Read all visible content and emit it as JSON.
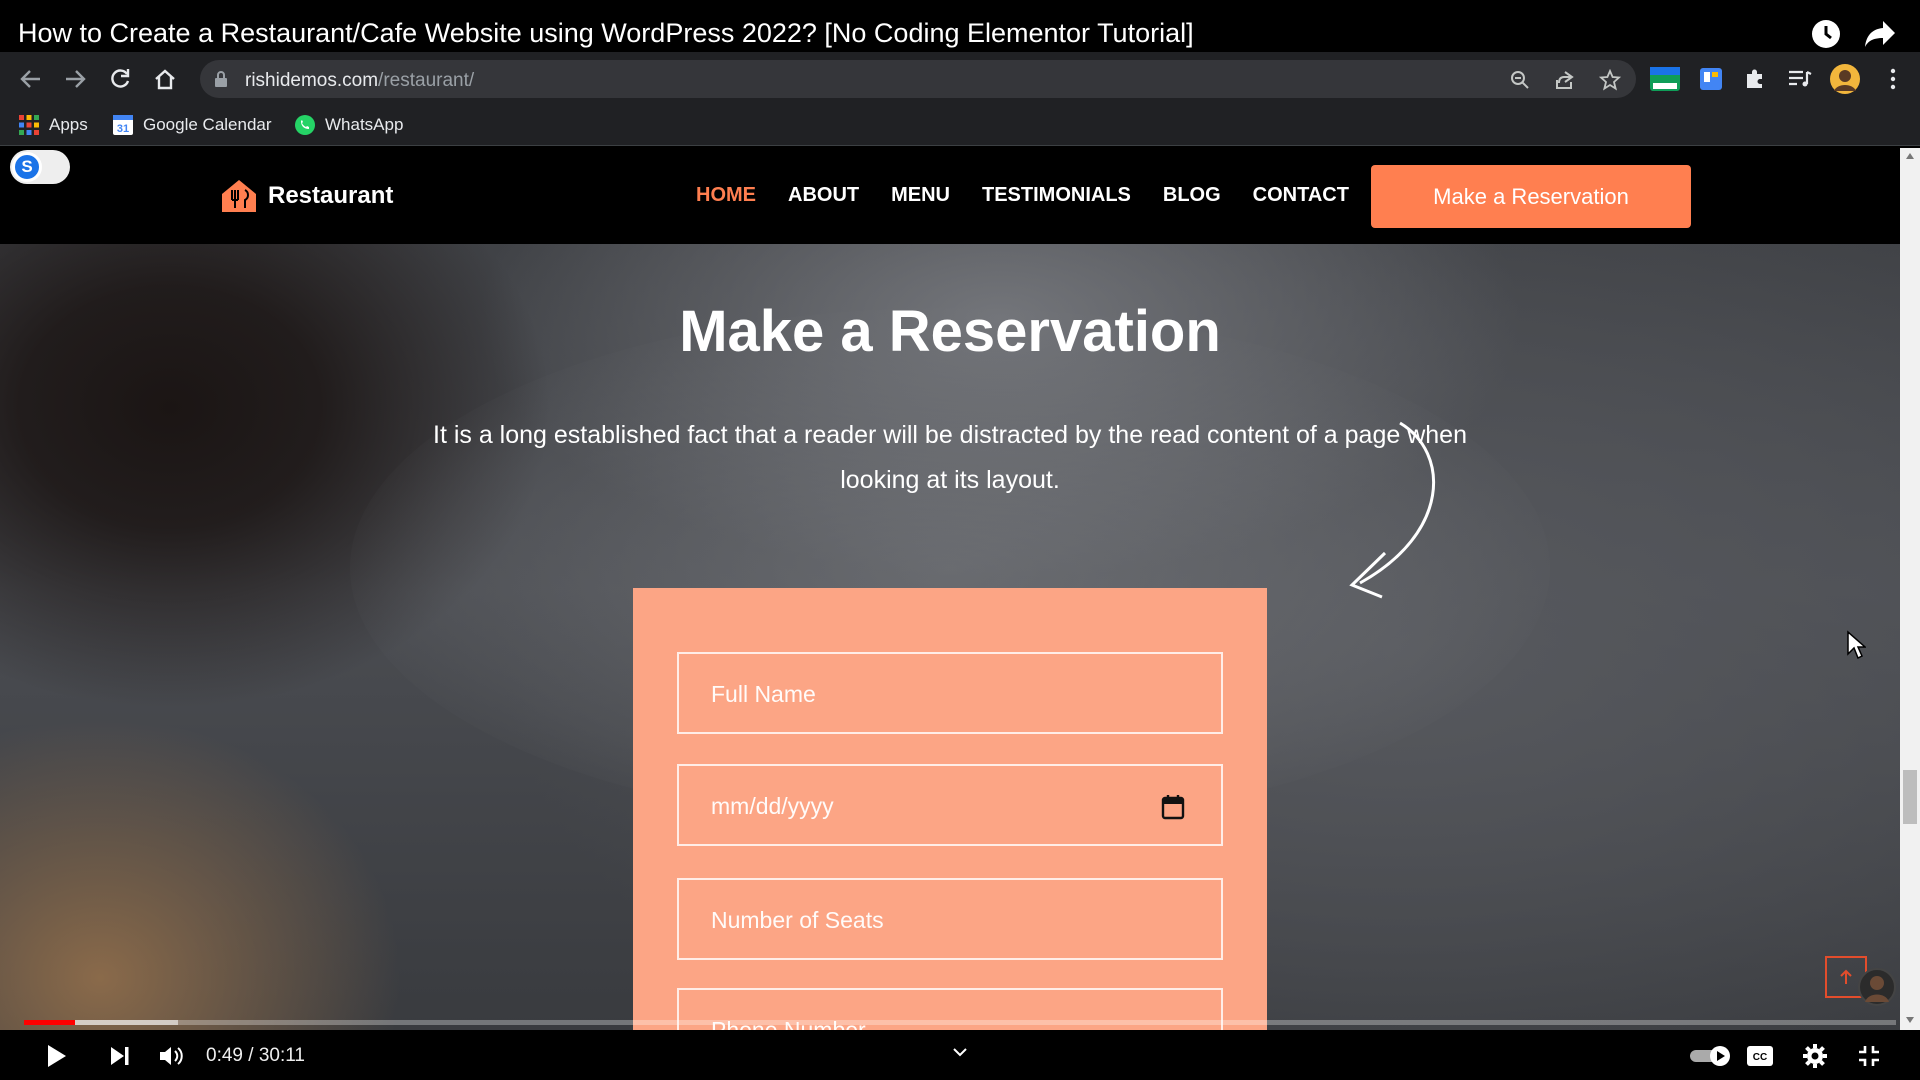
{
  "video": {
    "title": "How to Create a Restaurant/Cafe Website using WordPress 2022? [No Coding Elementor Tutorial]",
    "time_current": "0:49",
    "time_total": "30:11",
    "progress_fraction": 0.027,
    "buffered_fraction": 0.082
  },
  "browser": {
    "url_domain": "rishidemos.com",
    "url_path": "/restaurant/",
    "bookmarks": [
      {
        "label": "Apps",
        "icon": "apps-grid-icon"
      },
      {
        "label": "Google Calendar",
        "icon": "calendar-icon"
      },
      {
        "label": "WhatsApp",
        "icon": "whatsapp-icon"
      }
    ]
  },
  "site": {
    "logo_text": "Restaurant",
    "nav": [
      {
        "label": "HOME",
        "active": true
      },
      {
        "label": "ABOUT",
        "active": false
      },
      {
        "label": "MENU",
        "active": false
      },
      {
        "label": "TESTIMONIALS",
        "active": false
      },
      {
        "label": "BLOG",
        "active": false
      },
      {
        "label": "CONTACT",
        "active": false
      }
    ],
    "cta_label": "Make a Reservation",
    "accent_color": "#ff7f50"
  },
  "hero": {
    "title": "Make a Reservation",
    "subtitle": "It is a long established fact that a reader will be distracted by the read content of a page when looking at its layout."
  },
  "form": {
    "full_name_placeholder": "Full Name",
    "date_placeholder": "mm/dd/yyyy",
    "seats_placeholder": "Number of Seats",
    "phone_placeholder": "Phone Number",
    "background_color": "#fca585"
  },
  "toggle_letter": "S"
}
